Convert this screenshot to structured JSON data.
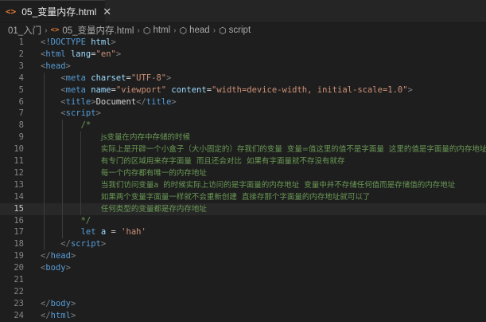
{
  "tab": {
    "icon": "<>",
    "label": "05_变量内存.html",
    "close": "✕"
  },
  "breadcrumb": {
    "folder": "01_入门",
    "file": "05_变量内存.html",
    "html": "html",
    "head": "head",
    "script": "script",
    "html_icon": "<>",
    "symbol_icon": "⬡"
  },
  "editor": {
    "active_line": 15,
    "lines": [
      {
        "n": "1",
        "tokens": [
          [
            "t-punc",
            "<"
          ],
          [
            "t-doctype",
            "!DOCTYPE"
          ],
          [
            "t-text",
            " "
          ],
          [
            "t-attr",
            "html"
          ],
          [
            "t-punc",
            ">"
          ]
        ]
      },
      {
        "n": "2",
        "tokens": [
          [
            "t-punc",
            "<"
          ],
          [
            "t-tag",
            "html"
          ],
          [
            "t-text",
            " "
          ],
          [
            "t-attr",
            "lang"
          ],
          [
            "t-text",
            "="
          ],
          [
            "t-str",
            "\"en\""
          ],
          [
            "t-punc",
            ">"
          ]
        ]
      },
      {
        "n": "3",
        "tokens": [
          [
            "t-punc",
            "<"
          ],
          [
            "t-tag",
            "head"
          ],
          [
            "t-punc",
            ">"
          ]
        ]
      },
      {
        "n": "4",
        "tokens": [
          [
            "t-text",
            "    "
          ],
          [
            "t-punc",
            "<"
          ],
          [
            "t-tag",
            "meta"
          ],
          [
            "t-text",
            " "
          ],
          [
            "t-attr",
            "charset"
          ],
          [
            "t-text",
            "="
          ],
          [
            "t-str",
            "\"UTF-8\""
          ],
          [
            "t-punc",
            ">"
          ]
        ]
      },
      {
        "n": "5",
        "tokens": [
          [
            "t-text",
            "    "
          ],
          [
            "t-punc",
            "<"
          ],
          [
            "t-tag",
            "meta"
          ],
          [
            "t-text",
            " "
          ],
          [
            "t-attr",
            "name"
          ],
          [
            "t-text",
            "="
          ],
          [
            "t-str",
            "\"viewport\""
          ],
          [
            "t-text",
            " "
          ],
          [
            "t-attr",
            "content"
          ],
          [
            "t-text",
            "="
          ],
          [
            "t-str",
            "\"width=device-width, initial-scale=1.0\""
          ],
          [
            "t-punc",
            ">"
          ]
        ]
      },
      {
        "n": "6",
        "tokens": [
          [
            "t-text",
            "    "
          ],
          [
            "t-punc",
            "<"
          ],
          [
            "t-tag",
            "title"
          ],
          [
            "t-punc",
            ">"
          ],
          [
            "t-text",
            "Document"
          ],
          [
            "t-punc",
            "</"
          ],
          [
            "t-tag",
            "title"
          ],
          [
            "t-punc",
            ">"
          ]
        ]
      },
      {
        "n": "7",
        "tokens": [
          [
            "t-text",
            "    "
          ],
          [
            "t-punc",
            "<"
          ],
          [
            "t-tag",
            "script"
          ],
          [
            "t-punc",
            ">"
          ]
        ]
      },
      {
        "n": "8",
        "tokens": [
          [
            "t-text",
            "        "
          ],
          [
            "t-comment",
            "/*"
          ]
        ]
      },
      {
        "n": "9",
        "tokens": [
          [
            "t-text",
            "            "
          ],
          [
            "t-comment-cn",
            "js变量在内存中存储的时候"
          ]
        ]
      },
      {
        "n": "10",
        "tokens": [
          [
            "t-text",
            "            "
          ],
          [
            "t-comment-cn",
            "实际上是开辟一个小盒子（大小固定的）存我们的变量  变量=值这里的值不是字面量  这里的值是字面量的内存地址"
          ]
        ]
      },
      {
        "n": "11",
        "tokens": [
          [
            "t-text",
            "            "
          ],
          [
            "t-comment-cn",
            "有专门的区域用来存字面量  而且还会对比  如果有字面量就不存没有就存"
          ]
        ]
      },
      {
        "n": "12",
        "tokens": [
          [
            "t-text",
            "            "
          ],
          [
            "t-comment-cn",
            "每一个内存都有唯一的内存地址"
          ]
        ]
      },
      {
        "n": "13",
        "tokens": [
          [
            "t-text",
            "            "
          ],
          [
            "t-comment-cn",
            "当我们访问变量a  的时候实际上访问的是字面量的内存地址  变量中并不存储任何值而是存储值的内存地址"
          ]
        ]
      },
      {
        "n": "14",
        "tokens": [
          [
            "t-text",
            "            "
          ],
          [
            "t-comment-cn",
            "如果两个变量字面量一样就不会重新创建  直接存那个字面量的内存地址就可以了"
          ]
        ]
      },
      {
        "n": "15",
        "tokens": [
          [
            "t-text",
            "            "
          ],
          [
            "t-comment-cn",
            "任何类型的变量都是存内存地址"
          ]
        ]
      },
      {
        "n": "16",
        "tokens": [
          [
            "t-text",
            "        "
          ],
          [
            "t-comment",
            "*/"
          ]
        ]
      },
      {
        "n": "17",
        "tokens": [
          [
            "t-text",
            "        "
          ],
          [
            "t-kw",
            "let"
          ],
          [
            "t-text",
            " "
          ],
          [
            "t-var",
            "a"
          ],
          [
            "t-op",
            " = "
          ],
          [
            "t-str",
            "'hah'"
          ]
        ]
      },
      {
        "n": "18",
        "tokens": [
          [
            "t-text",
            "    "
          ],
          [
            "t-punc",
            "</"
          ],
          [
            "t-tag",
            "script"
          ],
          [
            "t-punc",
            ">"
          ]
        ]
      },
      {
        "n": "19",
        "tokens": [
          [
            "t-punc",
            "</"
          ],
          [
            "t-tag",
            "head"
          ],
          [
            "t-punc",
            ">"
          ]
        ]
      },
      {
        "n": "20",
        "tokens": [
          [
            "t-punc",
            "<"
          ],
          [
            "t-tag",
            "body"
          ],
          [
            "t-punc",
            ">"
          ]
        ]
      },
      {
        "n": "21",
        "tokens": []
      },
      {
        "n": "22",
        "tokens": []
      },
      {
        "n": "23",
        "tokens": [
          [
            "t-punc",
            "</"
          ],
          [
            "t-tag",
            "body"
          ],
          [
            "t-punc",
            ">"
          ]
        ]
      },
      {
        "n": "24",
        "tokens": [
          [
            "t-punc",
            "</"
          ],
          [
            "t-tag",
            "html"
          ],
          [
            "t-punc",
            ">"
          ]
        ]
      }
    ]
  },
  "colors": {
    "background": "#1e1e1e",
    "tag": "#569cd6",
    "attribute": "#9cdcfe",
    "string": "#ce9178",
    "comment": "#6a9955",
    "html_icon": "#e37933"
  }
}
